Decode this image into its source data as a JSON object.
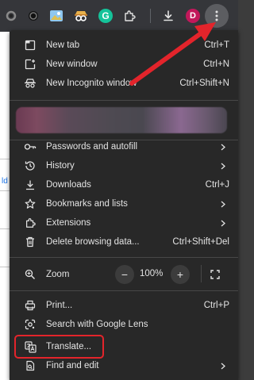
{
  "toolbar": {
    "avatar_letter": "D",
    "icons": [
      "circle-icon",
      "image-icon",
      "spy-icon",
      "grammarly-icon",
      "extensions-icon",
      "download-icon",
      "profile-avatar",
      "more-menu-icon"
    ]
  },
  "menu": {
    "new_tab": {
      "label": "New tab",
      "shortcut": "Ctrl+T"
    },
    "new_window": {
      "label": "New window",
      "shortcut": "Ctrl+N"
    },
    "new_incognito": {
      "label": "New Incognito window",
      "shortcut": "Ctrl+Shift+N"
    },
    "passwords": {
      "label": "Passwords and autofill"
    },
    "history": {
      "label": "History"
    },
    "downloads": {
      "label": "Downloads",
      "shortcut": "Ctrl+J"
    },
    "bookmarks": {
      "label": "Bookmarks and lists"
    },
    "extensions": {
      "label": "Extensions"
    },
    "delete_data": {
      "label": "Delete browsing data...",
      "shortcut": "Ctrl+Shift+Del"
    },
    "zoom": {
      "label": "Zoom",
      "value": "100%",
      "minus": "−",
      "plus": "+"
    },
    "print": {
      "label": "Print...",
      "shortcut": "Ctrl+P"
    },
    "lens": {
      "label": "Search with Google Lens"
    },
    "translate": {
      "label": "Translate..."
    },
    "find_edit": {
      "label": "Find and edit"
    }
  },
  "colors": {
    "menu_bg": "#282828",
    "text": "#e3e3e3",
    "annotation_red": "#e3242b",
    "avatar": "#c2185b"
  }
}
